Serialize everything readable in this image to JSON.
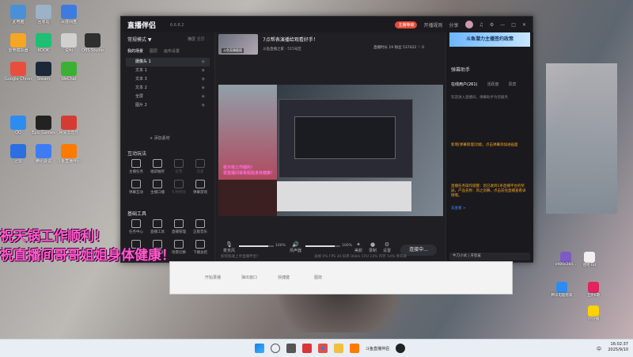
{
  "desktop": {
    "icons": [
      {
        "label": "此电脑",
        "color": "#4a90d9"
      },
      {
        "label": "回收站",
        "color": "#9bb2c9"
      },
      {
        "label": "百度网盘",
        "color": "#3e7be0"
      },
      {
        "label": "雷电模拟器",
        "color": "#f5a623"
      },
      {
        "label": "KOOK",
        "color": "#1dbf73"
      },
      {
        "label": "说明",
        "color": "#d0d0d0"
      },
      {
        "label": "OBS Studio",
        "color": "#2f2f2f"
      },
      {
        "label": "Google Chrome",
        "color": "#e94e3c"
      },
      {
        "label": "Steam",
        "color": "#1b2838"
      },
      {
        "label": "WeChat",
        "color": "#3cb034"
      },
      {
        "label": "QQ",
        "color": "#2d8cf0"
      },
      {
        "label": "Epic Games",
        "color": "#222"
      },
      {
        "label": "网易云音乐",
        "color": "#d43c33"
      },
      {
        "label": "迅雷",
        "color": "#2b6fe0"
      },
      {
        "label": "腾讯会议",
        "color": "#3d7cf5"
      },
      {
        "label": "斗鱼直播伴侣",
        "color": "#ff7a00"
      }
    ],
    "right_icons": [
      {
        "label": "e980c284...",
        "color": "#7c5cc4"
      },
      {
        "label": "哈哈.txt",
        "color": "#f0f0f0"
      },
      {
        "label": "腾讯电脑管家",
        "color": "#2d8cf0"
      },
      {
        "label": "全民K歌",
        "color": "#e0245e"
      },
      {
        "label": "YY开播",
        "color": "#ffd200"
      }
    ]
  },
  "app": {
    "title": "直播伴侣",
    "version": "6.6.8.2",
    "title_right": {
      "upgrade": "主播等级",
      "guard": "开播规则",
      "share": "分享",
      "badge": "New"
    },
    "left": {
      "mode_label": "常规模式 ▼",
      "mode_right": "横屏",
      "mode_right2": "竖屏",
      "tabs": [
        "我的场景",
        "图层",
        "画布设置"
      ],
      "scenes": [
        {
          "name": "摄像头 1"
        },
        {
          "name": "文本 1"
        },
        {
          "name": "文本 3"
        },
        {
          "name": "文本 2"
        },
        {
          "name": "全屏"
        },
        {
          "name": "图片 2"
        }
      ],
      "add_source": "+ 添加素材",
      "interactive_title": "互动玩法",
      "interactive_tools": [
        {
          "label": "主播任务"
        },
        {
          "label": "福袋抽奖"
        },
        {
          "label": "投票"
        },
        {
          "label": "连麦"
        },
        {
          "label": "弹幕互动"
        },
        {
          "label": "主播口播"
        },
        {
          "label": "礼物特效"
        },
        {
          "label": "弹幕游戏"
        }
      ],
      "basic_title": "基础工具",
      "basic_tools": [
        {
          "label": "任务中心"
        },
        {
          "label": "直播工具"
        },
        {
          "label": "直播管理"
        },
        {
          "label": "正版音乐"
        },
        {
          "label": "弹幕助手"
        },
        {
          "label": "画质设置"
        },
        {
          "label": "场景切换"
        },
        {
          "label": "下播总结"
        }
      ],
      "basic_side": "基础"
    },
    "middle": {
      "live_title": "7点帮表演播给观看好手！",
      "thumb_label": "斗鱼直播截图",
      "category": "斗鱼直播之家 · 515号区",
      "stats": "直播时长 19  粉丝 537422  ♡ 0",
      "preview_overlay": "祝天啦工作顺利！\n祝直播间哥哥姐姐身体健康！",
      "mic_label": "麦克风",
      "mic_value": "100%",
      "speaker_label": "扬声器",
      "speaker_value": "100%",
      "tool_beauty": "美颜",
      "tool_record": "录制",
      "tool_settings": "设置",
      "go_live": "连接中...",
      "mic_level": 0.85,
      "speaker_level": 0.85,
      "status": "如何快速上手直播伴侣？",
      "status_right": "丢帧 0%  FPS 30  码率 0kb/s  CPU 14%  内存 54%  单开关"
    },
    "right": {
      "banner": "斗鱼潜力主播签约政策",
      "panel_title": "弹幕助手",
      "tabs": [
        "在线用户(261)",
        "活跃度",
        "贵宾"
      ],
      "chat": [
        {
          "text": "欢迎进入直播间，弹幕助手为您服务",
          "color": "#888"
        },
        {
          "text": "新增[弹幕管理]功能，点击弹幕添加进画面",
          "color": "#f5a623"
        },
        {
          "text": "直播任务操作提醒：您已收到1条直播平台的奖励，产品名称：风之剑舞，点击前往直播查看详情哦。",
          "color": "#f5a623"
        },
        {
          "text": "去查看 >",
          "color": "#3d8bff"
        }
      ],
      "chat_input": "牛刀小试 | 牙签鲨"
    }
  },
  "overlay": {
    "line1": "祝天锅工作顺利！",
    "line2": "祝直播间哥哥姐姐身体健康！"
  },
  "obs": {
    "buttons": [
      "开始录播",
      "弹出窗口",
      "快捷键",
      "图效"
    ]
  },
  "taskbar": {
    "search_placeholder": "搜索",
    "app_label": "斗鱼直播伴侣",
    "tray_text": "中",
    "time": "16:02:37",
    "date": "2025/9/10"
  }
}
